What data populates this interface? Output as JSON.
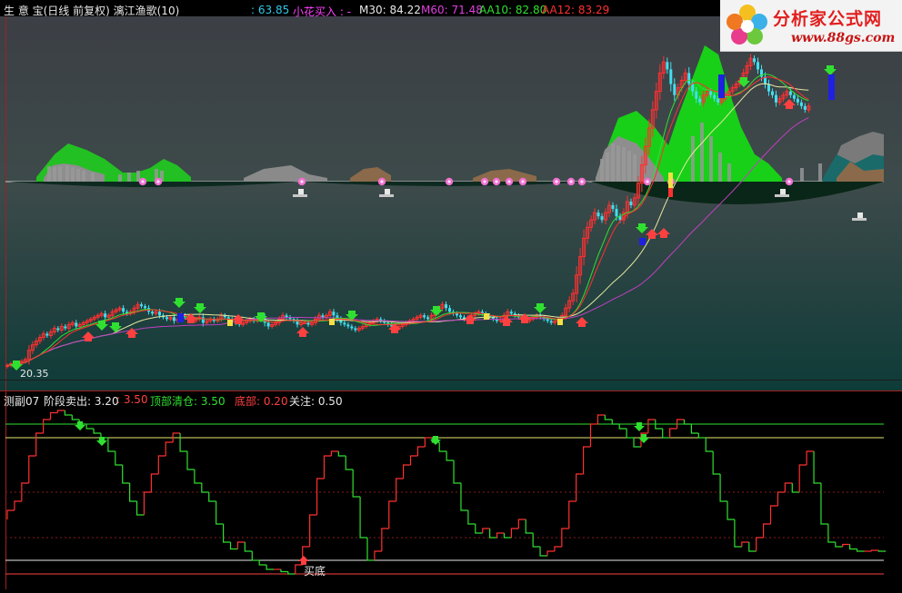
{
  "header": {
    "title": "生 意 宝(日线 前复权) 漓江渔歌(10)",
    "val1": ": 63.85",
    "signal": "小花买入 : -",
    "ma": [
      {
        "label": "M30: 84.22",
        "color": "#e8e8e8"
      },
      {
        "label": "M60: 71.48",
        "color": "#e040e0"
      },
      {
        "label": "AA10: 82.80",
        "color": "#30e030"
      },
      {
        "label": "AA12: 83.29",
        "color": "#ff3030"
      }
    ]
  },
  "logo": {
    "title": "分析家公式网",
    "url": "www.88gs.com"
  },
  "lower": {
    "name": "测副07",
    "items": [
      {
        "label": "阶段卖出: 3.20",
        "color": "#e8e8e8"
      },
      {
        "label": ": 3.50",
        "color": "#ff4040"
      },
      {
        "label": "顶部清仓: 3.50",
        "color": "#30e030"
      },
      {
        "label": "底部: 0.20",
        "color": "#ff4040"
      },
      {
        "label": "关注: 0.50",
        "color": "#e8e8e8"
      }
    ],
    "buy_label": "买底"
  },
  "chart_data": [
    {
      "type": "line",
      "title": "生 意 宝(日线 前复权) 漓江渔歌(10)",
      "note": "Upper candlestick price panel",
      "low_label": "20.35",
      "series": [
        {
          "name": "M30",
          "color": "#e8e8a0",
          "last": 84.22
        },
        {
          "name": "M60",
          "color": "#c040c0",
          "last": 71.48
        },
        {
          "name": "AA10",
          "color": "#30e030",
          "last": 82.8
        },
        {
          "name": "AA12",
          "color": "#ff3030",
          "last": 83.29
        }
      ],
      "x": [
        0,
        4,
        8,
        12,
        16,
        20,
        24,
        28,
        32,
        36,
        40,
        44,
        48,
        52,
        56,
        60,
        64,
        68,
        72,
        76,
        80,
        84,
        88,
        92,
        96,
        100,
        104,
        108,
        112,
        116,
        120,
        124,
        128,
        132,
        136,
        140,
        144,
        148,
        152,
        156,
        160,
        164,
        168,
        172,
        176,
        180,
        184,
        188,
        192,
        196,
        200,
        204,
        208,
        212,
        216,
        220,
        224,
        228,
        232,
        236,
        240,
        244,
        248,
        252,
        256,
        260,
        264,
        268,
        272,
        276,
        280,
        284,
        288,
        292,
        296,
        300,
        304,
        308,
        312,
        316,
        320,
        324,
        328,
        332,
        336,
        340,
        344,
        348,
        352,
        356,
        360,
        364,
        368,
        372,
        376,
        380,
        384,
        388,
        392,
        396,
        400,
        404,
        408,
        412,
        416,
        420,
        424,
        428,
        432,
        436,
        440,
        444,
        448,
        452,
        456,
        460,
        464,
        468,
        472,
        476,
        480,
        484,
        488,
        492,
        496,
        500,
        504,
        508,
        512,
        516,
        520,
        524,
        528,
        532,
        536,
        540,
        544,
        548,
        552,
        556,
        560,
        564,
        568,
        572,
        576,
        580,
        584,
        588,
        592,
        596,
        600,
        604,
        608,
        612,
        616,
        620,
        624,
        628,
        632,
        636,
        640,
        644,
        648,
        652,
        656,
        660,
        664,
        668,
        672,
        676,
        680,
        684,
        688,
        692,
        696,
        700,
        704,
        708,
        712,
        716,
        720,
        724,
        728,
        732,
        736,
        740,
        744,
        748,
        752,
        756,
        760,
        764,
        768,
        772,
        776,
        780,
        784,
        788,
        792,
        796,
        800,
        804,
        808,
        812,
        816,
        820,
        824,
        828,
        832,
        836,
        840,
        844,
        848,
        852,
        856,
        860,
        864,
        868,
        872,
        876,
        880,
        884,
        888,
        892,
        896,
        900,
        904,
        908,
        912,
        916,
        920,
        924,
        928,
        932,
        936,
        940,
        944,
        948,
        952,
        956,
        960,
        964
      ],
      "close": [
        20.4,
        20.8,
        21.2,
        21.0,
        21.5,
        22.0,
        24.5,
        26.0,
        27.0,
        28.0,
        29.0,
        28.5,
        29.5,
        30.5,
        30.0,
        31.0,
        30.5,
        31.5,
        32.0,
        31.0,
        31.5,
        32.0,
        32.5,
        33.0,
        33.5,
        34.0,
        34.5,
        33.5,
        34.0,
        35.0,
        35.5,
        36.0,
        35.0,
        34.5,
        35.0,
        36.0,
        37.0,
        36.5,
        36.0,
        35.0,
        34.5,
        35.0,
        34.0,
        33.5,
        33.0,
        33.5,
        32.5,
        33.0,
        34.0,
        33.5,
        33.0,
        32.5,
        33.0,
        33.5,
        32.0,
        32.5,
        33.0,
        32.5,
        33.0,
        34.0,
        33.5,
        33.0,
        32.5,
        32.0,
        31.5,
        32.0,
        32.5,
        33.0,
        32.5,
        33.0,
        33.5,
        32.0,
        31.0,
        31.5,
        32.0,
        33.0,
        34.0,
        33.5,
        33.0,
        32.5,
        31.5,
        32.0,
        32.0,
        31.5,
        32.0,
        33.0,
        34.0,
        33.5,
        34.0,
        35.0,
        34.0,
        33.0,
        32.0,
        31.5,
        31.0,
        30.5,
        30.0,
        30.5,
        31.0,
        31.5,
        32.0,
        32.5,
        33.0,
        32.5,
        32.0,
        31.5,
        31.0,
        30.5,
        31.0,
        31.5,
        32.0,
        32.5,
        33.0,
        33.5,
        34.0,
        33.5,
        33.0,
        34.0,
        35.0,
        36.0,
        37.0,
        36.0,
        35.0,
        34.5,
        34.0,
        33.5,
        33.0,
        33.5,
        34.0,
        34.5,
        35.0,
        34.5,
        34.0,
        33.5,
        33.0,
        32.5,
        33.0,
        34.0,
        35.0,
        34.5,
        34.0,
        33.5,
        33.0,
        32.5,
        33.0,
        33.5,
        34.0,
        33.5,
        33.0,
        32.5,
        32.0,
        32.5,
        33.0,
        34.0,
        36.0,
        38.0,
        40.0,
        45.0,
        50.0,
        55.0,
        58.0,
        60.0,
        62.0,
        61.0,
        60.0,
        62.0,
        64.0,
        63.0,
        61.0,
        60.0,
        62.0,
        65.0,
        64.0,
        66.0,
        70.0,
        75.0,
        80.0,
        85.0,
        90.0,
        95.0,
        100.0,
        103.0,
        101.0,
        97.0,
        94.0,
        96.0,
        98.0,
        100.0,
        97.0,
        95.0,
        93.0,
        92.0,
        94.0,
        95.0,
        94.0,
        93.0,
        92.0,
        93.0,
        94.0,
        95.0,
        96.0,
        97.0,
        98.0,
        100.0,
        102.0,
        104.0,
        103.0,
        101.0,
        99.0,
        97.0,
        95.0,
        94.0,
        92.0,
        93.0,
        94.0,
        95.0,
        94.0,
        93.0,
        92.0,
        91.0,
        90.0,
        91.0
      ]
    },
    {
      "type": "line",
      "title": "测副07",
      "note": "Lower oscillator panel (step line, red rising / green falling)",
      "ylim": [
        0,
        4
      ],
      "reference_lines": [
        {
          "name": "顶部清仓",
          "value": 3.5,
          "color": "#30e030"
        },
        {
          "name": "阶段卖出",
          "value": 3.2,
          "color": "#e8e870"
        },
        {
          "name": "关注",
          "value": 0.5,
          "color": "#e8e8e8"
        },
        {
          "name": "底部",
          "value": 0.2,
          "color": "#ff4040"
        }
      ],
      "x": [
        0,
        8,
        16,
        24,
        32,
        40,
        48,
        56,
        64,
        72,
        80,
        88,
        96,
        104,
        112,
        120,
        128,
        136,
        144,
        152,
        160,
        168,
        176,
        184,
        192,
        200,
        208,
        216,
        224,
        232,
        240,
        248,
        256,
        264,
        272,
        280,
        288,
        296,
        304,
        312,
        320,
        328,
        336,
        344,
        352,
        360,
        368,
        376,
        384,
        392,
        400,
        408,
        416,
        424,
        432,
        440,
        448,
        456,
        464,
        472,
        480,
        488,
        496,
        504,
        512,
        520,
        528,
        536,
        544,
        552,
        560,
        568,
        576,
        584,
        592,
        600,
        608,
        616,
        624,
        632,
        640,
        648,
        656,
        664,
        672,
        680,
        688,
        696,
        704,
        712,
        720,
        728,
        736,
        744,
        752,
        760,
        768,
        776,
        784,
        792,
        800,
        808,
        816,
        824,
        832,
        840,
        848,
        856,
        864,
        872,
        880,
        888,
        896,
        904,
        912,
        920,
        928,
        936,
        944,
        952,
        960,
        968,
        976
      ],
      "values": [
        1.4,
        1.6,
        1.8,
        2.2,
        2.8,
        3.3,
        3.6,
        3.75,
        3.8,
        3.7,
        3.6,
        3.5,
        3.4,
        3.3,
        3.2,
        2.9,
        2.6,
        2.2,
        1.8,
        1.5,
        2.0,
        2.4,
        2.8,
        3.1,
        3.3,
        2.9,
        2.5,
        2.2,
        2.0,
        1.8,
        1.3,
        0.9,
        0.75,
        0.9,
        0.7,
        0.5,
        0.4,
        0.3,
        0.3,
        0.25,
        0.2,
        0.4,
        0.8,
        1.5,
        2.3,
        2.8,
        2.9,
        2.8,
        2.5,
        1.9,
        1.0,
        0.5,
        0.7,
        1.2,
        1.8,
        2.3,
        2.6,
        2.8,
        3.0,
        3.2,
        3.1,
        2.9,
        2.7,
        2.2,
        1.6,
        1.3,
        1.1,
        1.2,
        1.0,
        1.1,
        1.0,
        1.2,
        1.4,
        1.1,
        0.8,
        0.6,
        0.7,
        0.8,
        1.2,
        1.8,
        2.4,
        3.0,
        3.5,
        3.7,
        3.6,
        3.5,
        3.4,
        3.2,
        3.0,
        3.3,
        3.6,
        3.4,
        3.2,
        3.4,
        3.6,
        3.5,
        3.3,
        3.2,
        2.9,
        2.4,
        1.8,
        1.4,
        0.8,
        0.9,
        0.7,
        1.0,
        1.3,
        1.7,
        2.0,
        2.2,
        2.0,
        2.6,
        2.9,
        2.2,
        1.3,
        0.9,
        0.8,
        0.85,
        0.75,
        0.7,
        0.7,
        0.72,
        0.7
      ]
    }
  ]
}
